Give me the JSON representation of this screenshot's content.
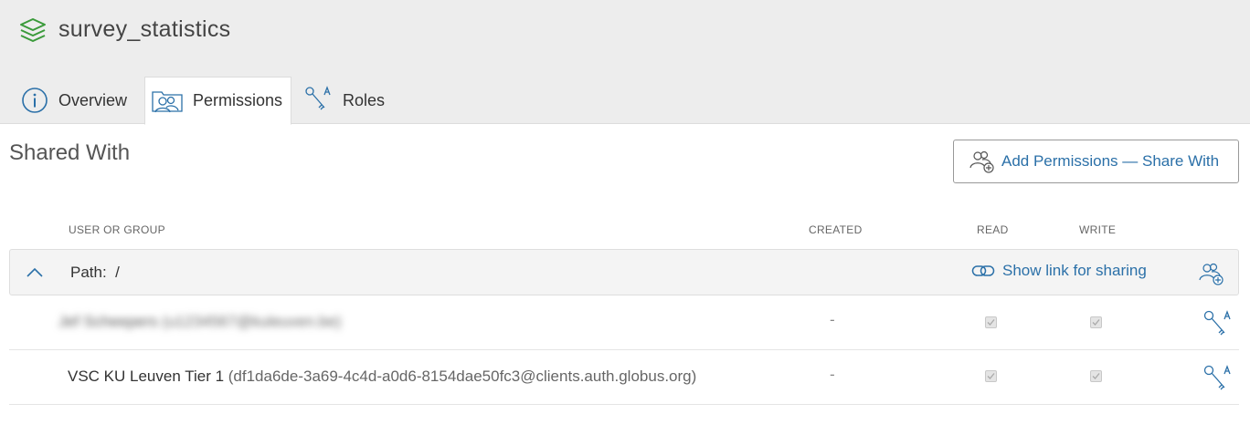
{
  "header": {
    "title": "survey_statistics",
    "logo_icon": "stack-layers-icon"
  },
  "tabs": [
    {
      "label": "Overview",
      "icon": "info-icon",
      "active": false
    },
    {
      "label": "Permissions",
      "icon": "users-folder-icon",
      "active": true
    },
    {
      "label": "Roles",
      "icon": "keys-icon",
      "active": false
    }
  ],
  "section": {
    "title": "Shared With",
    "add_button_label": "Add Permissions — Share With"
  },
  "table": {
    "columns": {
      "user": "USER OR GROUP",
      "created": "CREATED",
      "read": "READ",
      "write": "WRITE"
    },
    "path_row": {
      "label": "Path:  /",
      "share_link": "Show link for sharing"
    },
    "rows": [
      {
        "name": "Jef Scheepers",
        "identity": "(u1234567@kuleuven.be)",
        "redacted": true,
        "created": "-",
        "read": true,
        "write": true
      },
      {
        "name": "VSC KU Leuven Tier 1",
        "identity": "(df1da6de-3a69-4c4d-a0d6-8154dae50fc3@clients.auth.globus.org)",
        "redacted": false,
        "created": "-",
        "read": true,
        "write": true
      }
    ]
  },
  "colors": {
    "accent": "#2b70a8",
    "logo": "#3a9a3a",
    "header_bg": "#ededed"
  }
}
